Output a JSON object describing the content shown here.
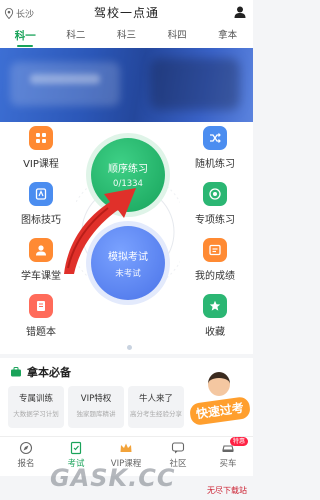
{
  "header": {
    "location": "长沙",
    "title": "驾校一点通"
  },
  "tabs": [
    {
      "label": "科一",
      "active": true
    },
    {
      "label": "科二",
      "active": false
    },
    {
      "label": "科三",
      "active": false
    },
    {
      "label": "科四",
      "active": false
    },
    {
      "label": "拿本",
      "active": false
    }
  ],
  "grid": {
    "left": [
      {
        "label": "VIP课程",
        "icon": "grid-icon",
        "color": "#ff8a33"
      },
      {
        "label": "图标技巧",
        "icon": "sign-icon",
        "color": "#4b8df0"
      },
      {
        "label": "学车课堂",
        "icon": "classroom-icon",
        "color": "#ff8a33"
      },
      {
        "label": "错题本",
        "icon": "book-icon",
        "color": "#ff6b5a"
      }
    ],
    "right": [
      {
        "label": "随机练习",
        "icon": "shuffle-icon",
        "color": "#4b8df0"
      },
      {
        "label": "专项练习",
        "icon": "target-icon",
        "color": "#2bb673"
      },
      {
        "label": "我的成绩",
        "icon": "score-icon",
        "color": "#ff8a33"
      },
      {
        "label": "收藏",
        "icon": "star-icon",
        "color": "#2bb673"
      }
    ],
    "practice": {
      "title": "顺序练习",
      "progress": "0/1334"
    },
    "exam": {
      "title": "模拟考试",
      "status": "未考试"
    }
  },
  "must": {
    "title": "拿本必备",
    "cards": [
      {
        "title": "专属训练",
        "sub": "大数据学习计划"
      },
      {
        "title": "VIP特权",
        "sub": "独家题库精讲"
      },
      {
        "title": "牛人来了",
        "sub": "高分考生经验分享"
      }
    ],
    "promo": "快速过考"
  },
  "nav": [
    {
      "label": "报名",
      "icon": "compass-icon",
      "active": false
    },
    {
      "label": "考试",
      "icon": "exam-icon",
      "active": true
    },
    {
      "label": "VIP课程",
      "icon": "crown-icon",
      "active": false
    },
    {
      "label": "社区",
      "icon": "chat-icon",
      "active": false
    },
    {
      "label": "买车",
      "icon": "car-icon",
      "active": false,
      "badge": "特惠"
    }
  ],
  "watermark": {
    "text": "GASK.CC",
    "small": "无尽下载站"
  },
  "colors": {
    "accent": "#1aa35a",
    "blue": "#4a73e8",
    "arrow": "#e0302a"
  }
}
